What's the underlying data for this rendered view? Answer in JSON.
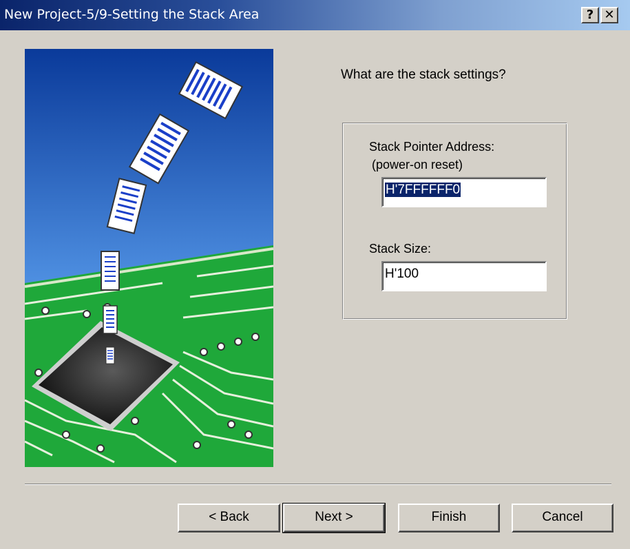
{
  "window": {
    "title": "New Project-5/9-Setting the Stack Area",
    "help_glyph": "?",
    "close_glyph": "✕"
  },
  "illustration": {
    "icon": "wizard-illustration-chip-documents",
    "colors": {
      "sky_top": "#0a3a9a",
      "sky_bottom": "#9cc8f0",
      "board": "#1fa83a",
      "trace": "#e8f0e0",
      "chip": "#2a2a2a"
    }
  },
  "content": {
    "question": "What are the stack settings?",
    "stack_pointer": {
      "label": "Stack Pointer Address:",
      "sublabel": "(power-on reset)",
      "value": "H'7FFFFFF0"
    },
    "stack_size": {
      "label": "Stack Size:",
      "value": "H'100"
    }
  },
  "buttons": {
    "back": "< Back",
    "next": "Next >",
    "finish": "Finish",
    "cancel": "Cancel"
  }
}
